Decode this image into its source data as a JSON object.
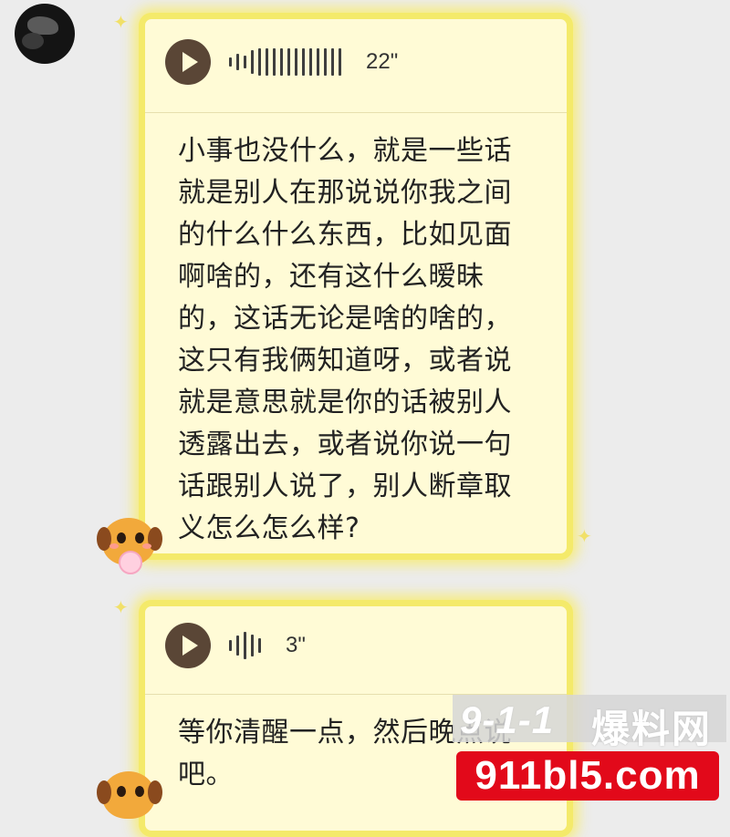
{
  "chat": {
    "messages": [
      {
        "sender": "other",
        "voice_duration": "22\"",
        "transcript": "小事也没什么，就是一些话\n就是别人在那说说你我之间\n的什么什么东西，比如见面\n啊啥的，还有这什么暧昧\n的，这话无论是啥的啥的，\n这只有我俩知道呀，或者说\n就是意思就是你的话被别人\n透露出去，或者说你说一句\n话跟别人说了，别人断章取\n义怎么怎么样?"
      },
      {
        "sender": "other",
        "voice_duration": "3\"",
        "transcript": "等你清醒一点，然后晚点说\n吧。"
      }
    ]
  },
  "watermark": {
    "logo": "9-1-1",
    "name_cn": "爆料网",
    "url": "911bl5.com"
  },
  "colors": {
    "bubble_fill": "#fffbd6",
    "bubble_glow": "#f4ea6a",
    "play_button": "#5a4636",
    "watermark_red": "#e2091a"
  },
  "icons": [
    "avatar",
    "play-icon",
    "waveform-icon",
    "sparkle-icon",
    "dog-emoji-badge"
  ]
}
